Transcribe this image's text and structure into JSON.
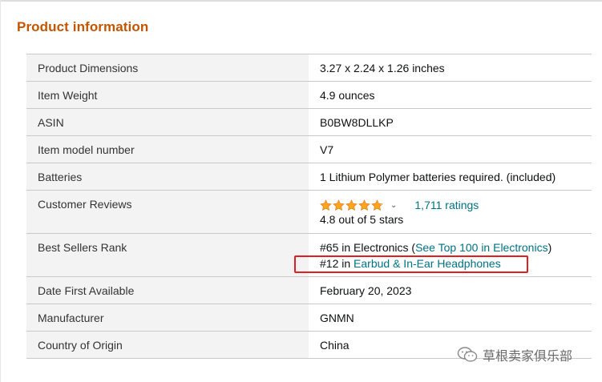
{
  "section": {
    "title": "Product information"
  },
  "rows": [
    {
      "label": "Product Dimensions",
      "value": "3.27 x 2.24 x 1.26 inches"
    },
    {
      "label": "Item Weight",
      "value": "4.9 ounces"
    },
    {
      "label": "ASIN",
      "value": "B0BW8DLLKP"
    },
    {
      "label": "Item model number",
      "value": "V7"
    },
    {
      "label": "Batteries",
      "value": "1 Lithium Polymer batteries required. (included)"
    }
  ],
  "reviews": {
    "label": "Customer Reviews",
    "rating_stars": 4.8,
    "ratings_link": "1,711 ratings",
    "rating_text": "4.8 out of 5 stars"
  },
  "rank": {
    "label": "Best Sellers Rank",
    "line1_prefix": "#65 in Electronics (",
    "line1_link": "See Top 100 in Electronics",
    "line1_suffix": ")",
    "line2_prefix": "#12 in ",
    "line2_link": "Earbud & In-Ear Headphones"
  },
  "rows_after": [
    {
      "label": "Date First Available",
      "value": "February 20, 2023"
    },
    {
      "label": "Manufacturer",
      "value": "GNMN"
    },
    {
      "label": "Country of Origin",
      "value": "China"
    }
  ],
  "watermark": {
    "text": "草根卖家俱乐部",
    "icon": "wechat-icon"
  },
  "colors": {
    "title": "#c45500",
    "link": "#007185",
    "star": "#ffa41c",
    "highlight": "#e02020",
    "label_bg": "#f3f3f3"
  }
}
